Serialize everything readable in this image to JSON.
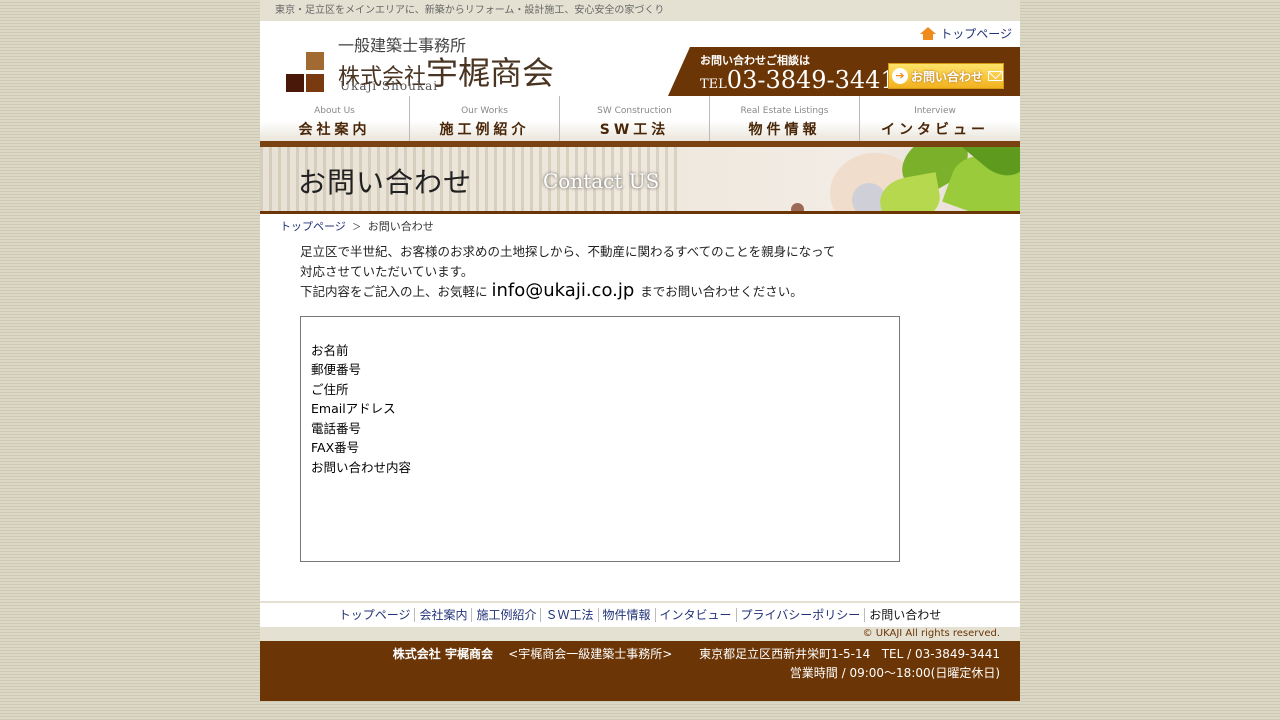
{
  "tagline": "東京・足立区をメインエリアに、新築からリフォーム・設計施工、安心安全の家づくり",
  "header": {
    "logo_line1": "一般建築士事務所",
    "logo_prefix": "株式会社",
    "logo_name": "宇梶商会",
    "logo_en": "Ukaji Shoukai",
    "top_link": "トップページ",
    "contact_label": "お問い合わせご相談は",
    "tel_prefix": "TEL",
    "tel_number": "03-3849-3441",
    "contact_button": "お問い合わせ"
  },
  "nav": [
    {
      "en": "About Us",
      "jp": "会社案内"
    },
    {
      "en": "Our Works",
      "jp": "施工例紹介"
    },
    {
      "en": "SW Construction",
      "jp": "SW工法"
    },
    {
      "en": "Real Estate Listings",
      "jp": "物件情報"
    },
    {
      "en": "Interview",
      "jp": "インタビュー"
    }
  ],
  "banner": {
    "title_jp": "お問い合わせ",
    "title_en": "Contact US"
  },
  "breadcrumb": {
    "home": "トップページ",
    "separator": "＞",
    "current": "お問い合わせ"
  },
  "intro": {
    "line1": "足立区で半世紀、お客様のお求めの土地探しから、不動産に関わるすべてのことを親身になって",
    "line2": "対応させていただいています。",
    "line3_before": "下記内容をご記入の上、お気軽に",
    "email": "info@ukaji.co.jp",
    "line3_after": "までお問い合わせください。"
  },
  "form_fields": [
    "お名前",
    "郵便番号",
    "ご住所",
    "Emailアドレス",
    "電話番号",
    "FAX番号",
    "お問い合わせ内容"
  ],
  "footer_links": [
    "トップページ",
    "会社案内",
    "施工例紹介",
    "ＳＷ工法",
    "物件情報",
    "インタビュー",
    "プライバシーポリシー"
  ],
  "footer_current": "お問い合わせ",
  "copyright": "© UKAJI All rights reserved.",
  "footer": {
    "company": "株式会社 宇梶商会",
    "office": "<宇梶商会一級建築士事務所>",
    "address": "東京都足立区西新井栄町1-5-14",
    "tel": "TEL / 03-3849-3441",
    "hours": "営業時間 / 09:00～18:00(日曜定休日)"
  },
  "colors": {
    "brown": "#6b3506",
    "link": "#223377",
    "accent_orange": "#f08a1c"
  }
}
